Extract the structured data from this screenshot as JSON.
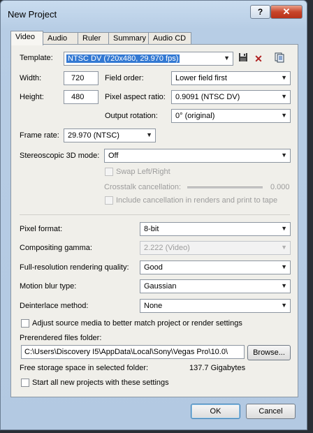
{
  "window": {
    "title": "New Project",
    "help": "?",
    "close": "✕"
  },
  "tabs": [
    "Video",
    "Audio",
    "Ruler",
    "Summary",
    "Audio CD"
  ],
  "video": {
    "template_label": "Template:",
    "template_value": "NTSC DV (720x480, 29.970 fps)",
    "width_label": "Width:",
    "width_value": "720",
    "height_label": "Height:",
    "height_value": "480",
    "field_order_label": "Field order:",
    "field_order_value": "Lower field first",
    "par_label": "Pixel aspect ratio:",
    "par_value": "0.9091 (NTSC DV)",
    "rotation_label": "Output rotation:",
    "rotation_value": "0° (original)",
    "frame_rate_label": "Frame rate:",
    "frame_rate_value": "29.970 (NTSC)",
    "stereo_label": "Stereoscopic 3D mode:",
    "stereo_value": "Off",
    "swap_label": "Swap Left/Right",
    "crosstalk_label": "Crosstalk cancellation:",
    "crosstalk_value": "0.000",
    "include_cancel_label": "Include cancellation in renders and print to tape",
    "pixel_format_label": "Pixel format:",
    "pixel_format_value": "8-bit",
    "gamma_label": "Compositing gamma:",
    "gamma_value": "2.222 (Video)",
    "fullres_label": "Full-resolution rendering quality:",
    "fullres_value": "Good",
    "motion_blur_label": "Motion blur type:",
    "motion_blur_value": "Gaussian",
    "deinterlace_label": "Deinterlace method:",
    "deinterlace_value": "None",
    "adjust_label": "Adjust source media to better match project or render settings",
    "prerender_label": "Prerendered files folder:",
    "prerender_value": "C:\\Users\\Discovery I5\\AppData\\Local\\Sony\\Vegas Pro\\10.0\\",
    "browse_label": "Browse...",
    "free_space_label": "Free storage space in selected folder:",
    "free_space_value": "137.7 Gigabytes",
    "start_all_label": "Start all new projects with these settings"
  },
  "buttons": {
    "ok": "OK",
    "cancel": "Cancel"
  },
  "icons": {
    "save": "save-icon",
    "delete": "delete-icon",
    "template-info": "template-info-icon"
  }
}
